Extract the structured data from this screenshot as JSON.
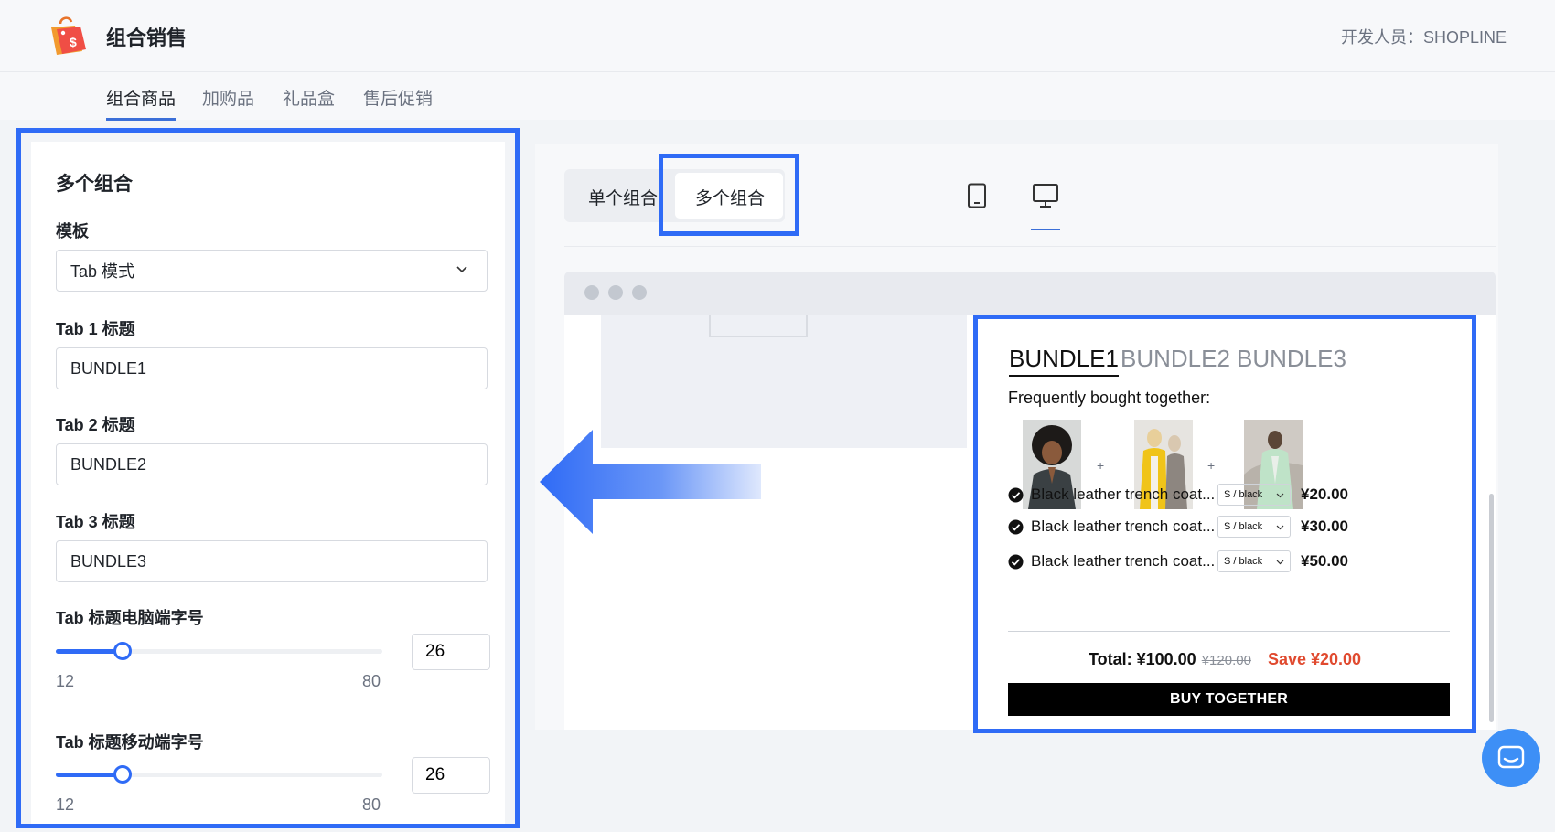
{
  "app": {
    "title": "组合销售",
    "developer": "开发人员：SHOPLINE"
  },
  "nav": {
    "tabs": [
      {
        "label": "组合商品",
        "active": true
      },
      {
        "label": "加购品",
        "active": false
      },
      {
        "label": "礼品盒",
        "active": false
      },
      {
        "label": "售后促销",
        "active": false
      }
    ]
  },
  "settings": {
    "title": "多个组合",
    "template": {
      "label": "模板",
      "value": "Tab 模式"
    },
    "tab1": {
      "label": "Tab 1 标题",
      "value": "BUNDLE1"
    },
    "tab2": {
      "label": "Tab 2 标题",
      "value": "BUNDLE2"
    },
    "tab3": {
      "label": "Tab 3 标题",
      "value": "BUNDLE3"
    },
    "desktop_font": {
      "label": "Tab 标题电脑端字号",
      "min": "12",
      "max": "80",
      "value": "26"
    },
    "mobile_font": {
      "label": "Tab 标题移动端字号",
      "min": "12",
      "max": "80",
      "value": "26"
    }
  },
  "preview": {
    "segments": {
      "single": "单个组合",
      "multiple": "多个组合",
      "active": "multiple"
    },
    "devices": [
      {
        "icon": "mobile-icon",
        "active": false
      },
      {
        "icon": "desktop-icon",
        "active": true
      }
    ],
    "bundle": {
      "tabs": [
        "BUNDLE1",
        "BUNDLE2",
        "BUNDLE3"
      ],
      "active_tab": 0,
      "heading": "Frequently bought together:",
      "items": [
        {
          "name": "Black leather trench coat...",
          "variant": "S / black",
          "price": "¥20.00"
        },
        {
          "name": "Black leather trench coat...",
          "variant": "S / black",
          "price": "¥30.00"
        },
        {
          "name": "Black leather trench coat...",
          "variant": "S / black",
          "price": "¥50.00"
        }
      ],
      "total_label": "Total: ¥100.00",
      "original_price": "¥120.00",
      "save_text": "Save ¥20.00",
      "buy_button": "BUY TOGETHER"
    }
  },
  "colors": {
    "accent": "#2f6bf6",
    "save_red": "#e04a2f",
    "chat_blue": "#3d8ff6"
  }
}
